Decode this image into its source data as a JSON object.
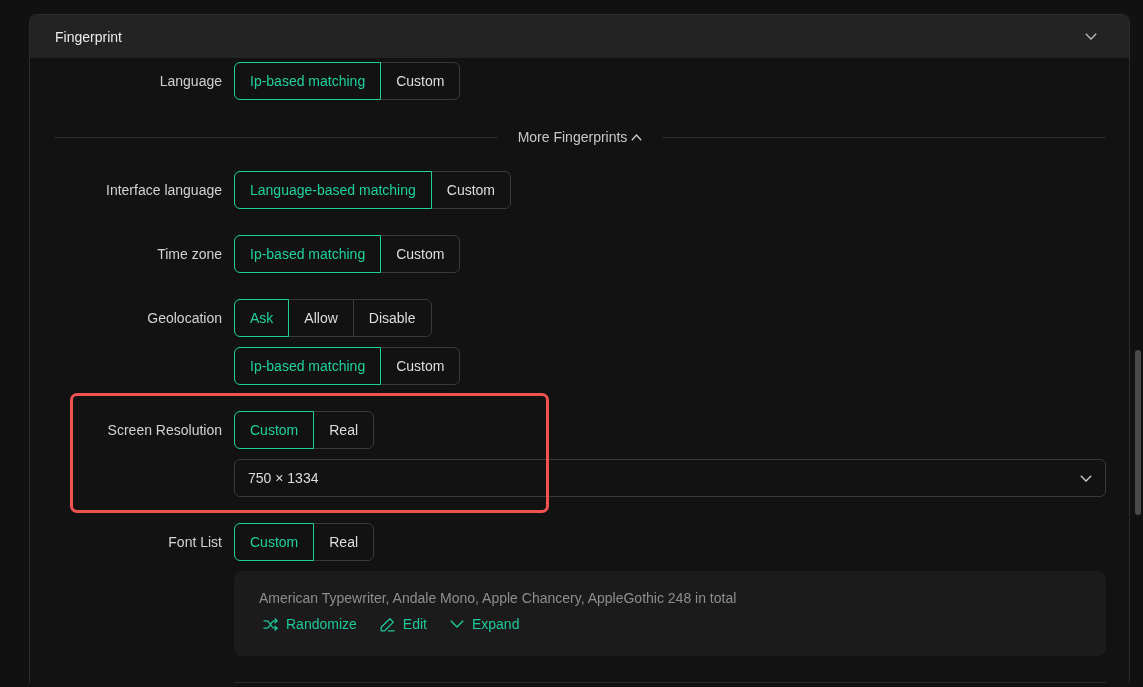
{
  "panel": {
    "title": "Fingerprint",
    "expanded": true
  },
  "settings": [
    {
      "kind": "field",
      "label": "Language",
      "highlighted": false,
      "controls": [
        {
          "kind": "segmented",
          "options": [
            {
              "label": "Ip-based matching",
              "selected": true
            },
            {
              "label": "Custom",
              "selected": false
            }
          ]
        }
      ]
    },
    {
      "kind": "toggle",
      "label": "More Fingerprints",
      "expanded": true
    },
    {
      "kind": "field",
      "label": "Interface language",
      "highlighted": false,
      "controls": [
        {
          "kind": "segmented",
          "options": [
            {
              "label": "Language-based matching",
              "selected": true
            },
            {
              "label": "Custom",
              "selected": false
            }
          ]
        }
      ]
    },
    {
      "kind": "field",
      "label": "Time zone",
      "highlighted": false,
      "controls": [
        {
          "kind": "segmented",
          "options": [
            {
              "label": "Ip-based matching",
              "selected": true
            },
            {
              "label": "Custom",
              "selected": false
            }
          ]
        }
      ]
    },
    {
      "kind": "field",
      "label": "Geolocation",
      "highlighted": false,
      "controls": [
        {
          "kind": "segmented",
          "options": [
            {
              "label": "Ask",
              "selected": true
            },
            {
              "label": "Allow",
              "selected": false
            },
            {
              "label": "Disable",
              "selected": false
            }
          ]
        },
        {
          "kind": "segmented",
          "options": [
            {
              "label": "Ip-based matching",
              "selected": true
            },
            {
              "label": "Custom",
              "selected": false
            }
          ]
        }
      ]
    },
    {
      "kind": "field",
      "label": "Screen Resolution",
      "highlighted": true,
      "controls": [
        {
          "kind": "segmented",
          "options": [
            {
              "label": "Custom",
              "selected": true
            },
            {
              "label": "Real",
              "selected": false
            }
          ]
        },
        {
          "kind": "select",
          "value": "750 × 1334"
        }
      ]
    },
    {
      "kind": "field",
      "label": "Font List",
      "highlighted": false,
      "controls": [
        {
          "kind": "segmented",
          "options": [
            {
              "label": "Custom",
              "selected": true
            },
            {
              "label": "Real",
              "selected": false
            }
          ]
        },
        {
          "kind": "font_list",
          "text": "American Typewriter, Andale Mono, Apple Chancery, AppleGothic 248 in total",
          "actions": [
            {
              "kind": "randomize",
              "label": "Randomize"
            },
            {
              "kind": "edit",
              "label": "Edit"
            },
            {
              "kind": "expand",
              "label": "Expand"
            }
          ]
        }
      ]
    }
  ]
}
